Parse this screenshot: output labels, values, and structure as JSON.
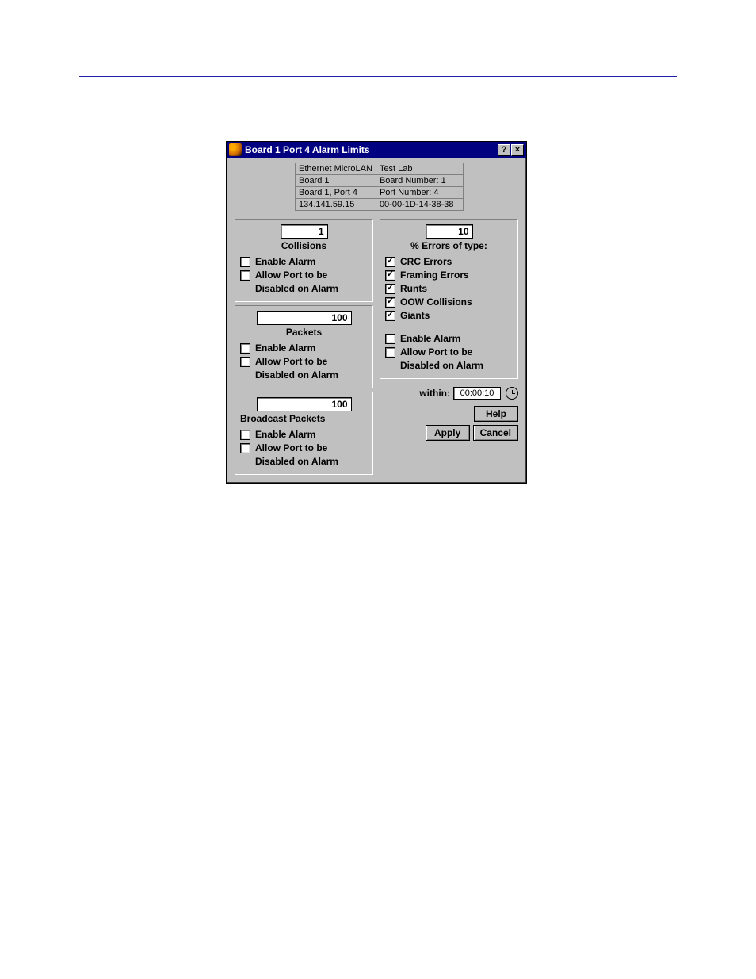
{
  "titlebar": {
    "title": "Board 1 Port 4 Alarm Limits",
    "help": "?",
    "close": "×"
  },
  "header": {
    "r1c1": "Ethernet MicroLAN",
    "r1c2": "Test Lab",
    "r2c1": "Board 1",
    "r2c2": "Board Number:  1",
    "r3c1": "Board 1, Port 4",
    "r3c2": "Port Number:  4",
    "r4c1": "134.141.59.15",
    "r4c2": "00-00-1D-14-38-38"
  },
  "collisions": {
    "value": "1",
    "label": "Collisions",
    "enable": "Enable Alarm",
    "allow1": "Allow Port to be",
    "allow2": "Disabled on Alarm"
  },
  "packets": {
    "value": "100",
    "label": "Packets",
    "enable": "Enable Alarm",
    "allow1": "Allow Port to be",
    "allow2": "Disabled on Alarm"
  },
  "broadcast": {
    "value": "100",
    "label": "Broadcast Packets",
    "enable": "Enable Alarm",
    "allow1": "Allow Port to be",
    "allow2": "Disabled on Alarm"
  },
  "errors": {
    "value": "10",
    "label": "% Errors of type:",
    "crc": "CRC Errors",
    "framing": "Framing Errors",
    "runts": "Runts",
    "oow": "OOW Collisions",
    "giants": "Giants",
    "enable": "Enable Alarm",
    "allow1": "Allow Port to be",
    "allow2": "Disabled on Alarm"
  },
  "within": {
    "label": "within:",
    "value": "00:00:10"
  },
  "buttons": {
    "help": "Help",
    "apply": "Apply",
    "cancel": "Cancel"
  }
}
